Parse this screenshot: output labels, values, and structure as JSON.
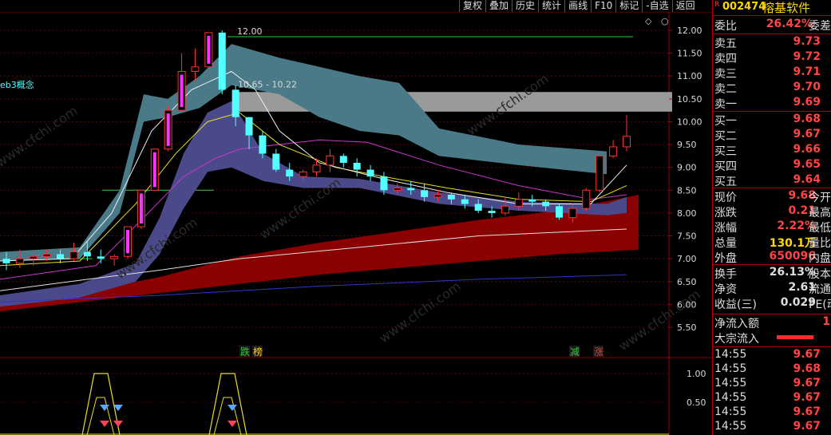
{
  "toolbar": [
    "复权",
    "叠加",
    "历史",
    "统计",
    "画线",
    "F10",
    "标记",
    "-自选",
    "返回"
  ],
  "chart": {
    "concept_label": "eb3概念",
    "high_label": "12.00",
    "range_label": "10.65 - 10.22",
    "watermark": "www.cfchi.com",
    "y_ticks": [
      "12.00",
      "11.50",
      "11.00",
      "10.50",
      "10.00",
      "9.50",
      "9.00",
      "8.50",
      "8.00",
      "7.50",
      "7.00",
      "6.50",
      "6.00",
      "5.50"
    ],
    "sub_y_ticks": [
      "1.00",
      "0.50"
    ],
    "signals": [
      {
        "text": "跌",
        "color": "#2ecc40"
      },
      {
        "text": "榜",
        "color": "#ffd700"
      },
      {
        "text": "减",
        "color": "#2ecc40"
      },
      {
        "text": "涨",
        "color": "#ff3333"
      }
    ]
  },
  "stock": {
    "flag": "R",
    "code": "002474",
    "name": "榕基软件"
  },
  "committee": {
    "label": "委比",
    "value": "26.42%",
    "tail": "委差"
  },
  "asks": [
    {
      "label": "卖五",
      "price": "9.73"
    },
    {
      "label": "卖四",
      "price": "9.72"
    },
    {
      "label": "卖三",
      "price": "9.71"
    },
    {
      "label": "卖二",
      "price": "9.70"
    },
    {
      "label": "卖一",
      "price": "9.69"
    }
  ],
  "bids": [
    {
      "label": "买一",
      "price": "9.68"
    },
    {
      "label": "买二",
      "price": "9.67"
    },
    {
      "label": "买三",
      "price": "9.66"
    },
    {
      "label": "买四",
      "price": "9.65"
    },
    {
      "label": "买五",
      "price": "9.64"
    }
  ],
  "quote": [
    {
      "label": "现价",
      "value": "9.68",
      "tail": "今开",
      "color": "#ff4444"
    },
    {
      "label": "涨跌",
      "value": "0.21",
      "tail": "最高",
      "color": "#ff4444"
    },
    {
      "label": "涨幅",
      "value": "2.22%",
      "tail": "最低",
      "color": "#ff4444"
    },
    {
      "label": "总量",
      "value": "130.1万",
      "tail": "量比",
      "color": "#ffd700"
    },
    {
      "label": "外盘",
      "value": "650096",
      "tail": "内盘",
      "color": "#ff4444"
    }
  ],
  "finance": [
    {
      "label": "换手",
      "value": "26.13%",
      "tail": "股本",
      "color": "#ddd"
    },
    {
      "label": "净资",
      "value": "2.61",
      "tail": "流通",
      "color": "#ddd"
    },
    {
      "label": "收益(三)",
      "value": "0.029",
      "tail": "PE(动",
      "color": "#ddd"
    }
  ],
  "flow": [
    {
      "label": "净流入额",
      "value": "1"
    },
    {
      "label": "大宗流入",
      "value": ""
    }
  ],
  "ticks": [
    {
      "time": "14:55",
      "price": "9.67"
    },
    {
      "time": "14:55",
      "price": "9.68"
    },
    {
      "time": "14:55",
      "price": "9.67"
    },
    {
      "time": "14:55",
      "price": "9.67"
    },
    {
      "time": "14:55",
      "price": "9.67"
    },
    {
      "time": "14:55",
      "price": "9.67"
    }
  ],
  "chart_data": {
    "type": "candlestick",
    "ylim": [
      5.3,
      12.3
    ],
    "high_marker": 12.0,
    "gap_zone": [
      10.22,
      10.65
    ],
    "candles": [
      [
        7.0,
        6.9,
        7.15,
        6.75
      ],
      [
        6.9,
        7.0,
        7.2,
        6.8
      ],
      [
        7.0,
        7.05,
        7.15,
        6.85
      ],
      [
        7.05,
        7.1,
        7.2,
        6.95
      ],
      [
        7.1,
        7.0,
        7.2,
        6.9
      ],
      [
        7.0,
        7.15,
        7.35,
        6.95
      ],
      [
        7.15,
        7.05,
        7.4,
        6.95
      ],
      [
        7.05,
        7.0,
        7.2,
        6.9
      ],
      [
        7.0,
        7.05,
        7.1,
        6.85
      ],
      [
        7.05,
        7.7,
        7.7,
        7.0
      ],
      [
        7.7,
        8.5,
        8.5,
        7.65
      ],
      [
        8.5,
        9.4,
        9.4,
        8.5
      ],
      [
        9.4,
        10.25,
        10.35,
        9.35
      ],
      [
        10.25,
        11.1,
        11.5,
        10.2
      ],
      [
        11.1,
        11.2,
        11.6,
        10.9
      ],
      [
        11.2,
        11.95,
        11.95,
        11.0
      ],
      [
        11.95,
        10.7,
        12.0,
        10.6
      ],
      [
        10.7,
        10.1,
        10.8,
        9.9
      ],
      [
        10.1,
        9.7,
        10.1,
        9.4
      ],
      [
        9.7,
        9.3,
        9.8,
        9.2
      ],
      [
        9.3,
        8.95,
        9.4,
        8.9
      ],
      [
        8.95,
        8.8,
        9.1,
        8.7
      ],
      [
        8.8,
        8.9,
        8.95,
        8.7
      ],
      [
        8.9,
        9.05,
        9.2,
        8.8
      ],
      [
        9.05,
        9.25,
        9.4,
        8.9
      ],
      [
        9.25,
        9.1,
        9.3,
        9.0
      ],
      [
        9.1,
        8.95,
        9.2,
        8.8
      ],
      [
        8.95,
        8.8,
        9.05,
        8.7
      ],
      [
        8.8,
        8.5,
        8.9,
        8.4
      ],
      [
        8.5,
        8.55,
        8.65,
        8.4
      ],
      [
        8.55,
        8.5,
        8.7,
        8.4
      ],
      [
        8.5,
        8.35,
        8.65,
        8.25
      ],
      [
        8.35,
        8.4,
        8.5,
        8.25
      ],
      [
        8.4,
        8.3,
        8.45,
        8.2
      ],
      [
        8.3,
        8.2,
        8.4,
        8.1
      ],
      [
        8.2,
        8.05,
        8.3,
        8.0
      ],
      [
        8.05,
        8.0,
        8.15,
        7.9
      ],
      [
        8.0,
        8.15,
        8.35,
        7.95
      ],
      [
        8.15,
        8.3,
        8.45,
        8.05
      ],
      [
        8.3,
        8.25,
        8.4,
        8.15
      ],
      [
        8.25,
        8.15,
        8.3,
        8.05
      ],
      [
        8.15,
        7.9,
        8.2,
        7.85
      ],
      [
        7.9,
        8.1,
        8.2,
        7.8
      ],
      [
        8.1,
        8.5,
        8.55,
        8.05
      ],
      [
        8.5,
        9.25,
        9.3,
        8.45
      ],
      [
        9.25,
        9.45,
        9.6,
        9.2
      ],
      [
        9.45,
        9.68,
        10.15,
        9.35
      ]
    ],
    "sub_indicator": {
      "type": "line",
      "ylim": [
        0,
        1.1
      ]
    }
  }
}
